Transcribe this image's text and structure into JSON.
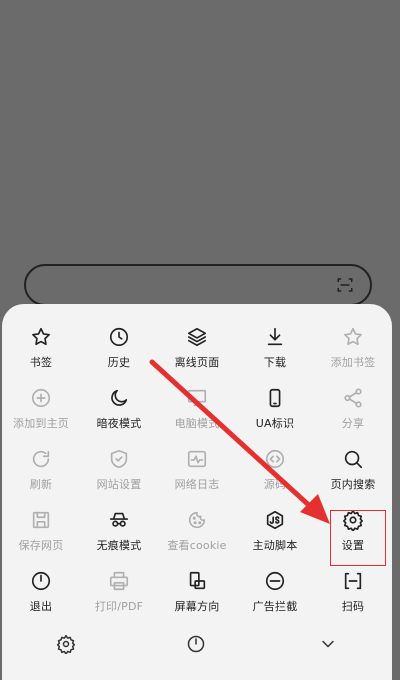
{
  "menu": {
    "items": [
      {
        "label": "书签",
        "icon": "star-icon",
        "enabled": true
      },
      {
        "label": "历史",
        "icon": "clock-icon",
        "enabled": true
      },
      {
        "label": "离线页面",
        "icon": "layers-icon",
        "enabled": true
      },
      {
        "label": "下载",
        "icon": "download-icon",
        "enabled": true
      },
      {
        "label": "添加书签",
        "icon": "star-icon",
        "enabled": false
      },
      {
        "label": "添加到主页",
        "icon": "plus-circle-icon",
        "enabled": false
      },
      {
        "label": "暗夜模式",
        "icon": "moon-icon",
        "enabled": true
      },
      {
        "label": "电脑模式",
        "icon": "monitor-icon",
        "enabled": false
      },
      {
        "label": "UA标识",
        "icon": "phone-icon",
        "enabled": true
      },
      {
        "label": "分享",
        "icon": "share-icon",
        "enabled": false
      },
      {
        "label": "刷新",
        "icon": "refresh-icon",
        "enabled": false
      },
      {
        "label": "网站设置",
        "icon": "shield-icon",
        "enabled": false
      },
      {
        "label": "网络日志",
        "icon": "activity-icon",
        "enabled": false
      },
      {
        "label": "源码",
        "icon": "code-icon",
        "enabled": false
      },
      {
        "label": "页内搜索",
        "icon": "search-icon",
        "enabled": true
      },
      {
        "label": "保存网页",
        "icon": "save-icon",
        "enabled": false
      },
      {
        "label": "无痕模式",
        "icon": "incognito-icon",
        "enabled": true
      },
      {
        "label": "查看cookie",
        "icon": "cookie-icon",
        "enabled": false
      },
      {
        "label": "主动脚本",
        "icon": "script-icon",
        "enabled": true
      },
      {
        "label": "设置",
        "icon": "gear-icon",
        "enabled": true
      },
      {
        "label": "退出",
        "icon": "power-icon",
        "enabled": true
      },
      {
        "label": "打印/PDF",
        "icon": "printer-icon",
        "enabled": false
      },
      {
        "label": "屏幕方向",
        "icon": "rotate-icon",
        "enabled": true
      },
      {
        "label": "广告拦截",
        "icon": "block-icon",
        "enabled": true
      },
      {
        "label": "扫码",
        "icon": "scan-icon",
        "enabled": true
      }
    ]
  },
  "bottom_bar": {
    "icons": [
      "gear-icon",
      "power-icon",
      "chevron-down-icon"
    ]
  },
  "annotation": {
    "highlight_color": "#e53030",
    "target": "设置"
  }
}
